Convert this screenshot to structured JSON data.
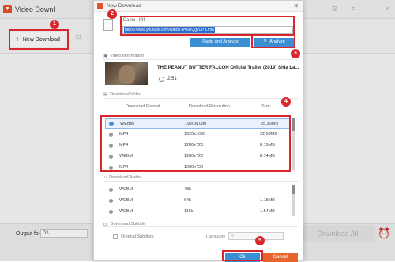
{
  "app": {
    "title": "Video Downl",
    "new_download": "New Download",
    "toolbar_other": "Cl",
    "output_label": "Output folder:",
    "output_value": "D:\\",
    "download_all": "Download All"
  },
  "dialog": {
    "title": "New Download",
    "paste_url_label": "Paste URL",
    "url_value": "https://www.youtube.com/watch?v=kDQgvUPILmM",
    "paste_analyze": "Paste and Analyze",
    "analyze": "Analyze",
    "video_info_label": "Video Information",
    "video_title": "THE PEANUT BUTTER FALCON Official Trailer (2019) Shia La...",
    "duration": "2:51",
    "download_video_label": "Download Video",
    "col_format": "Download Format",
    "col_resolution": "Download Resolution",
    "col_size": "Size",
    "video_rows": [
      {
        "format": "WEBM",
        "resolution": "1920x1080",
        "size": "25.30MB",
        "selected": true
      },
      {
        "format": "MP4",
        "resolution": "1920x1080",
        "size": "22.99MB",
        "selected": false
      },
      {
        "format": "MP4",
        "resolution": "1280x720",
        "size": "8.19MB",
        "selected": false
      },
      {
        "format": "WEBM",
        "resolution": "1280x720",
        "size": "8.74MB",
        "selected": false
      },
      {
        "format": "MP4",
        "resolution": "1280x720",
        "size": "",
        "selected": false
      }
    ],
    "download_audio_label": "Download Audio",
    "audio_rows": [
      {
        "format": "WEBM",
        "bitrate": "48k",
        "size": "-"
      },
      {
        "format": "WEBM",
        "bitrate": "64k",
        "size": "1.18MB"
      },
      {
        "format": "WEBM",
        "bitrate": "115k",
        "size": "1.54MB"
      }
    ],
    "subtitle_label": "Download Subtitle",
    "original_subtitles": "Original Subtitles",
    "language_label": "Language",
    "language_value": "fil",
    "ok": "Ok",
    "cancel": "Cancel"
  },
  "badges": [
    "1",
    "2",
    "3",
    "4",
    "5"
  ],
  "colors": {
    "accent": "#3a8fd4",
    "brand": "#e8502a",
    "annotation": "#d9262c",
    "cancel": "#e8642e"
  }
}
